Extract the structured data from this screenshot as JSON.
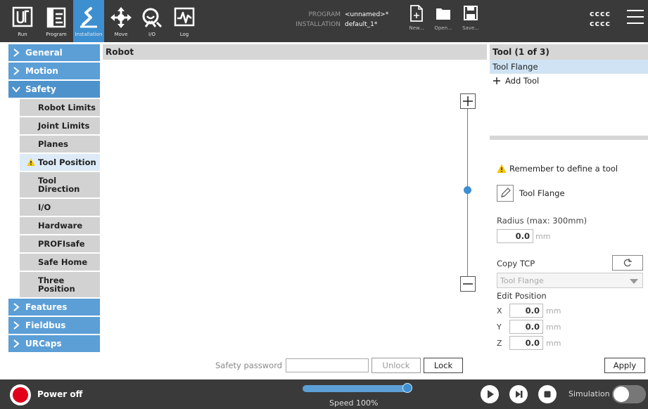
{
  "topbar": {
    "nav": [
      {
        "id": "run",
        "label": "Run",
        "icon": "ur-logo-icon"
      },
      {
        "id": "program",
        "label": "Program",
        "icon": "program-icon"
      },
      {
        "id": "installation",
        "label": "Installation",
        "icon": "installation-icon",
        "active": true
      },
      {
        "id": "move",
        "label": "Move",
        "icon": "move-icon"
      },
      {
        "id": "io",
        "label": "I/O",
        "icon": "io-icon"
      },
      {
        "id": "log",
        "label": "Log",
        "icon": "log-icon"
      }
    ],
    "program_key": "PROGRAM",
    "program_value": "<unnamed>*",
    "installation_key": "INSTALLATION",
    "installation_value": "default_1*",
    "file_buttons": {
      "new": "New...",
      "open": "Open...",
      "save": "Save..."
    },
    "user_line1": "cccc",
    "user_line2": "cccc"
  },
  "leftnav": {
    "sections": {
      "general": "General",
      "motion": "Motion",
      "safety": "Safety",
      "features": "Features",
      "fieldbus": "Fieldbus",
      "urcaps": "URCaps"
    },
    "safety_items": {
      "robot_limits": "Robot Limits",
      "joint_limits": "Joint Limits",
      "planes": "Planes",
      "tool_position": "Tool Position",
      "tool_direction_1": "Tool",
      "tool_direction_2": "Direction",
      "io": "I/O",
      "hardware": "Hardware",
      "profisafe": "PROFIsafe",
      "safe_home": "Safe Home",
      "three_position_1": "Three",
      "three_position_2": "Position"
    }
  },
  "center": {
    "header": "Robot"
  },
  "right": {
    "header": "Tool (1 of 3)",
    "tools": [
      "Tool Flange"
    ],
    "add_tool": "Add Tool",
    "remember": "Remember to define a tool",
    "tool_name": "Tool Flange",
    "radius_label": "Radius (max: 300mm)",
    "radius_value": "0.0",
    "unit": "mm",
    "copy_tcp_label": "Copy TCP",
    "tcp_select_value": "Tool Flange",
    "edit_position_label": "Edit Position",
    "position": [
      {
        "axis": "X",
        "value": "0.0"
      },
      {
        "axis": "Y",
        "value": "0.0"
      },
      {
        "axis": "Z",
        "value": "0.0"
      }
    ]
  },
  "bottom": {
    "password_label": "Safety password",
    "unlock": "Unlock",
    "lock": "Lock",
    "apply": "Apply"
  },
  "footer": {
    "power_label": "Power off",
    "speed_label": "Speed 100%",
    "speed_fraction": 1.0,
    "simulation_label": "Simulation"
  },
  "colors": {
    "accent": "#3d8fd0",
    "nav_section": "#5b9fd6",
    "warning": "#f5c400",
    "power": "#e3001b",
    "bar": "#3a3a3a"
  }
}
